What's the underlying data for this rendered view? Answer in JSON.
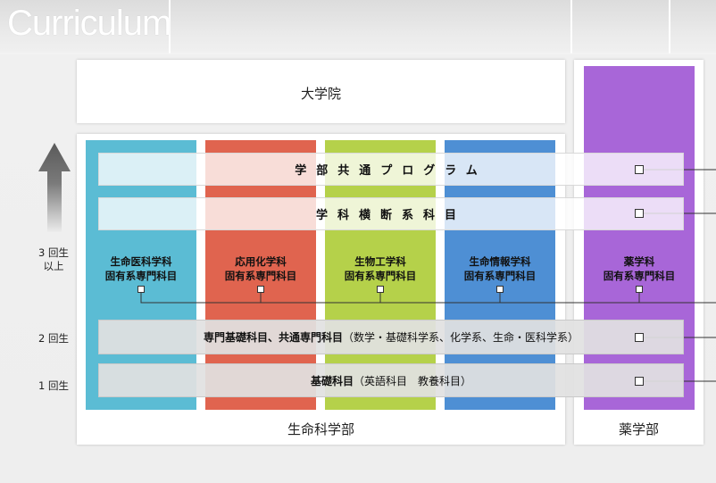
{
  "title": "Curriculum",
  "graduate": {
    "label": "大学院"
  },
  "faculties": [
    {
      "label": "生命科学部"
    },
    {
      "label": "薬学部"
    }
  ],
  "columns": [
    {
      "line1": "生命医科学科",
      "line2": "固有系専門科目",
      "color": "#5bbcd4"
    },
    {
      "line1": "応用化学科",
      "line2": "固有系専門科目",
      "color": "#e0644f"
    },
    {
      "line1": "生物工学科",
      "line2": "固有系専門科目",
      "color": "#b5d14a"
    },
    {
      "line1": "生命情報学科",
      "line2": "固有系専門科目",
      "color": "#4e8fd4"
    },
    {
      "line1": "薬学科",
      "line2": "固有系専門科目",
      "color": "#a866d8"
    }
  ],
  "bands": {
    "common_program": "学部共通プログラム",
    "cross_department": "学科横断系科目",
    "specialized_bold": "専門基礎科目、共通専門科目",
    "specialized_detail": "（数学・基礎科学系、化学系、生命・医科学系）",
    "basic_bold": "基礎科目",
    "basic_detail": "（英語科目　教養科目）"
  },
  "years": {
    "year3_line1": "3 回生",
    "year3_line2": "以上",
    "year2": "2 回生",
    "year1": "1 回生"
  },
  "colors": {
    "arrow_top": "#5a5a5a",
    "arrow_bottom": "#e8e8e8",
    "band_grey": "#e1e1e1"
  }
}
